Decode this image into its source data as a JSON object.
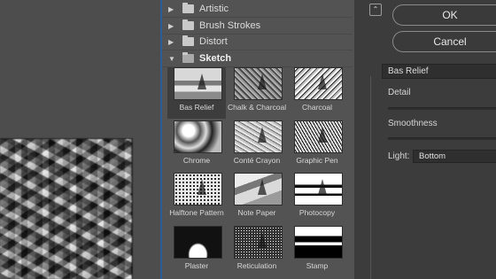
{
  "gallery": {
    "folders": [
      {
        "label": "Artistic",
        "icon": "triangle-right-icon"
      },
      {
        "label": "Brush Strokes",
        "icon": "triangle-right-icon"
      },
      {
        "label": "Distort",
        "icon": "triangle-right-icon"
      },
      {
        "label": "Sketch",
        "icon": "triangle-down-icon",
        "open": true
      }
    ],
    "thumbnails": [
      {
        "label": "Bas Relief",
        "selected": true
      },
      {
        "label": "Chalk & Charcoal"
      },
      {
        "label": "Charcoal"
      },
      {
        "label": "Chrome"
      },
      {
        "label": "Conté Crayon"
      },
      {
        "label": "Graphic Pen"
      },
      {
        "label": "Halftone Pattern"
      },
      {
        "label": "Note Paper"
      },
      {
        "label": "Photocopy"
      },
      {
        "label": "Plaster"
      },
      {
        "label": "Reticulation"
      },
      {
        "label": "Stamp"
      }
    ],
    "selection_color": "#2b5c9c"
  },
  "dialog": {
    "ok_label": "OK",
    "cancel_label": "Cancel",
    "collapse_glyph": "⌃"
  },
  "settings": {
    "filter_name": "Bas Relief",
    "detail_label": "Detail",
    "smoothness_label": "Smoothness",
    "light_label": "Light:",
    "light_value": "Bottom"
  }
}
